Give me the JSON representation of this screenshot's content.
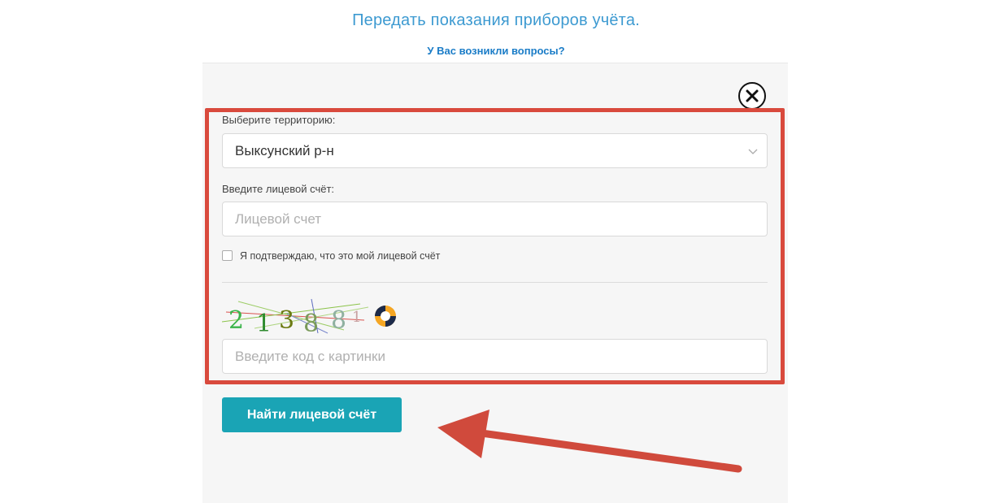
{
  "header": {
    "title": "Передать показания приборов учёта.",
    "help_link": "У Вас возникли вопросы?"
  },
  "form": {
    "territory_label": "Выберите территорию:",
    "territory_value": "Выксунский р-н",
    "account_label": "Введите лицевой счёт:",
    "account_placeholder": "Лицевой счет",
    "confirm_label": "Я подтверждаю, что это мой лицевой счёт",
    "confirm_checked": false,
    "captcha_text": "213881",
    "captcha_placeholder": "Введите код с картинки",
    "submit_label": "Найти лицевой счёт"
  },
  "icons": {
    "close": "close-icon",
    "dropdown": "chevron-down-icon",
    "refresh": "refresh-icon"
  },
  "colors": {
    "title": "#3d9ad1",
    "link": "#1a7cc7",
    "button": "#1aa4b5",
    "highlight": "#d94a3d"
  }
}
